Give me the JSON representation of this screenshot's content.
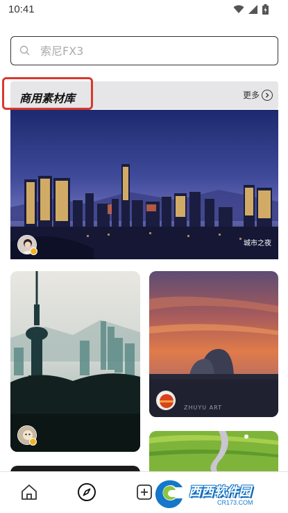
{
  "status_bar": {
    "time": "10:41",
    "icons": [
      "wifi-icon",
      "signal-icon",
      "battery-icon"
    ]
  },
  "search": {
    "placeholder": "索尼FX3",
    "icon": "search-icon"
  },
  "section": {
    "title": "商用素材库",
    "more_label": "更多",
    "highlight_color": "#d9382d"
  },
  "featured": {
    "caption": "城市之夜"
  },
  "cards": [
    {
      "name": "tower-skyline",
      "has_avatar": true
    },
    {
      "name": "sunset-theater",
      "has_avatar": true,
      "watermark": "ZHUYU ART"
    },
    {
      "name": "green-fields",
      "has_avatar": false
    }
  ],
  "bottom_nav": {
    "items": [
      "home-icon",
      "discover-icon",
      "add-icon"
    ],
    "active": "discover-icon"
  },
  "site_watermark": {
    "name": "西西软件园",
    "url_text": "CR173.COM"
  }
}
